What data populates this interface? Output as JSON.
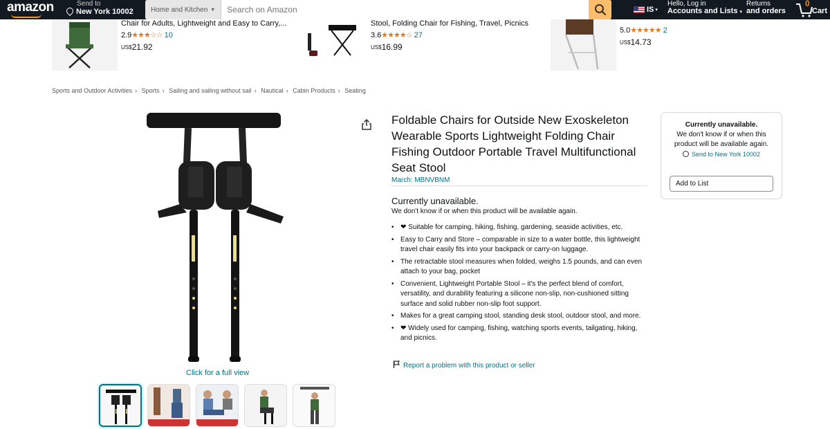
{
  "nav": {
    "logo": "amazon",
    "deliver_line1": "Send to",
    "deliver_line2": "New York 10002",
    "search_category": "Home and Kitchen",
    "search_placeholder": "Search on Amazon",
    "language": "IS",
    "account_line1": "Hello, Log in",
    "account_line2": "Accounts and Lists",
    "returns_line1": "Returns",
    "returns_line2": "and orders",
    "cart_count": "0",
    "cart_label": "Cart"
  },
  "sponsored": [
    {
      "title": "Chair for Adults, Lightweight and Easy to Carry,...",
      "rating": "2.9",
      "stars": "★★★☆☆",
      "count": "10",
      "currency": "US$",
      "price": "21.92"
    },
    {
      "title": "Stool, Folding Chair for Fishing, Travel, Picnics",
      "rating": "3.6",
      "stars": "★★★★☆",
      "count": "27",
      "currency": "US$",
      "price": "16.99"
    },
    {
      "title": "",
      "rating": "5.0",
      "stars": "★★★★★",
      "count": "2",
      "currency": "US$",
      "price": "14.73"
    }
  ],
  "breadcrumb": [
    "Sports and Outdoor Activities",
    "Sports",
    "Sailing and sailing without sail",
    "Nautical",
    "Cabin Products",
    "Seating"
  ],
  "product": {
    "title": "Foldable Chairs for Outside New Exoskeleton Wearable Sports Lightweight Folding Chair Fishing Outdoor Portable Travel Multifunctional Seat Stool",
    "brand": "March: MBNVBNM",
    "availability_head": "Currently unavailable.",
    "availability_sub": "We don't know if or when this product will be available again.",
    "bullets": [
      "❤ Suitable for camping, hiking, fishing, gardening, seaside activities, etc.",
      "Easy to Carry and Store – comparable in size to a water bottle, this lightweight travel chair easily fits into your backpack or carry-on luggage.",
      "The retractable stool measures when folded, weighs 1.5 pounds, and can even attach to your bag, pocket",
      "Convenient, Lightweight Portable Stool – it's the perfect blend of comfort, versatility, and durability featuring a silicone non-slip, non-cushioned sitting surface and solid rubber non-slip foot support.",
      "Makes for a great camping stool, standing desk stool, outdoor stool, and more.",
      "❤ Widely used for camping, fishing, watching sports events, tailgating, hiking, and picnics."
    ],
    "report_link": "Report a problem with this product or seller",
    "full_view": "Click for a full view"
  },
  "buybox": {
    "head": "Currently unavailable.",
    "text": "We don't know if or when this product will be available again.",
    "send_to": "Send to",
    "send_location": "New York 10002",
    "add_to_list": "Add to List"
  },
  "colors": {
    "nav_bg": "#131921",
    "search_button": "#febd69",
    "link": "#007185",
    "star": "#de7921"
  }
}
